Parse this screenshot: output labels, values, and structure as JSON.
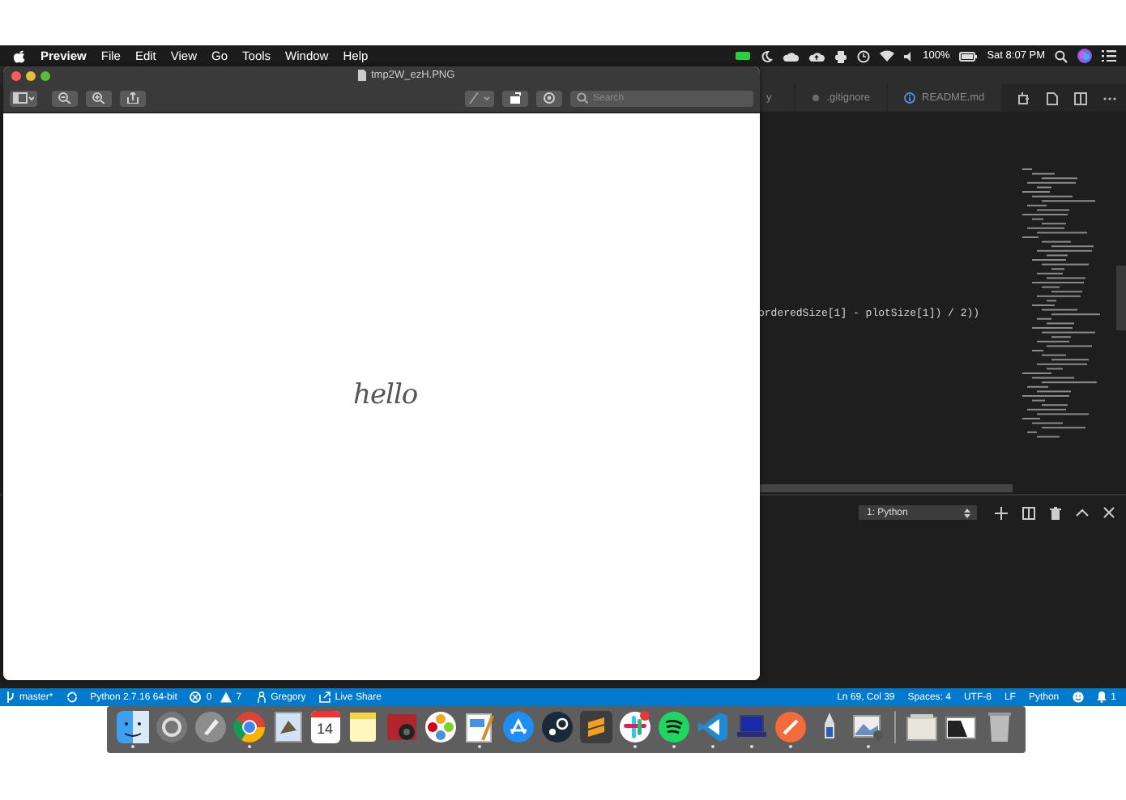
{
  "menu_bar": {
    "app": "Preview",
    "menus": [
      "File",
      "Edit",
      "View",
      "Go",
      "Tools",
      "Window",
      "Help"
    ],
    "battery": "100%",
    "clock": "Sat 8:07 PM"
  },
  "preview": {
    "title": "tmp2W_ezH.PNG",
    "search": {
      "placeholder": "Search"
    },
    "document_text": "hello"
  },
  "editor": {
    "tabs": [
      {
        "label": "y",
        "selected": false
      },
      {
        "label": ".gitignore",
        "selected": false
      },
      {
        "label": "README.md",
        "selected": false
      }
    ],
    "code_line": "orderedSize[1] - plotSize[1]) / 2))",
    "terminal": {
      "selector": "1: Python"
    }
  },
  "status_bar": {
    "branch": "master*",
    "interpreter": "Python 2.7.16 64-bit",
    "errors": "0",
    "warnings": "7",
    "user": "Gregory",
    "live_share": "Live Share",
    "position": "Ln 69, Col 39",
    "indent": "Spaces: 4",
    "encoding": "UTF-8",
    "eol": "LF",
    "language": "Python",
    "notifications": "1"
  },
  "dock": {
    "calendar_day": "14",
    "items": [
      {
        "running": true
      },
      {
        "running": false
      },
      {
        "running": false
      },
      {
        "running": true
      },
      {
        "running": false
      },
      {
        "running": false
      },
      {
        "running": false
      },
      {
        "running": false
      },
      {
        "running": false
      },
      {
        "running": true
      },
      {
        "running": false
      },
      {
        "running": false
      },
      {
        "running": false
      },
      {
        "running": true
      },
      {
        "running": true
      },
      {
        "running": true
      },
      {
        "running": true
      },
      {
        "running": true
      },
      {
        "running": false
      },
      {
        "running": true
      },
      {
        "running": false
      },
      {
        "running": false
      },
      {
        "running": false
      }
    ]
  }
}
